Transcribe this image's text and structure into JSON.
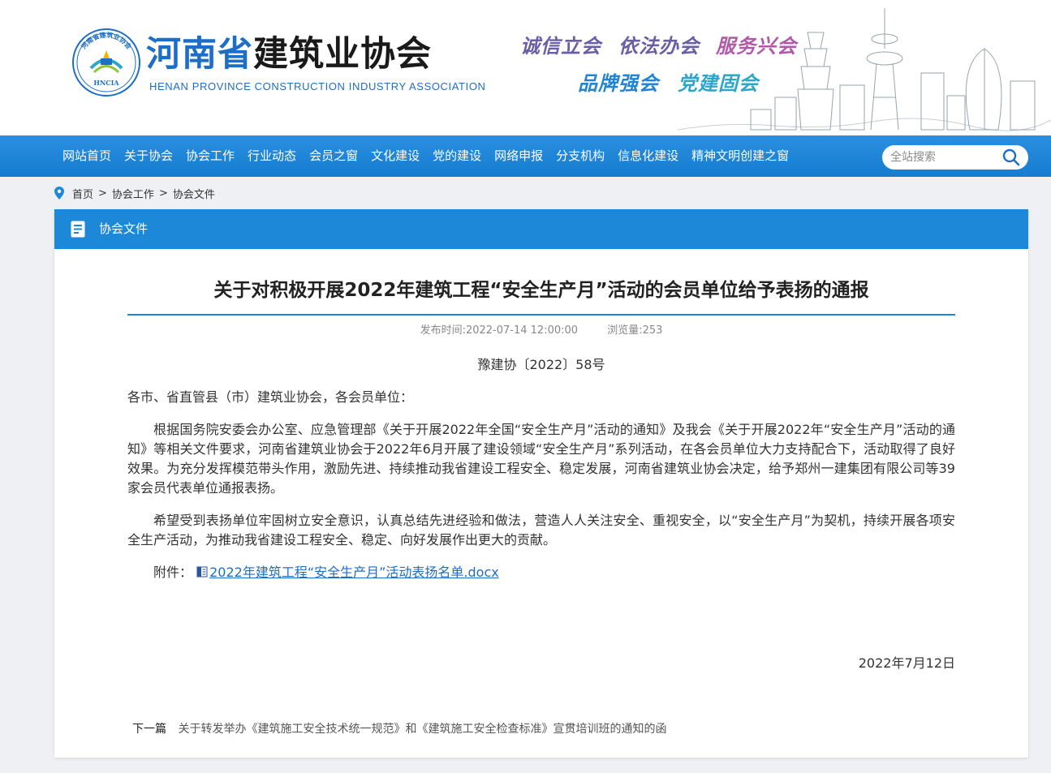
{
  "header": {
    "title_part1": "河南省",
    "title_part2": "建筑业协会",
    "subtitle": "HENAN PROVINCE CONSTRUCTION INDUSTRY ASSOCIATION",
    "emblem_top_text": "河南省建筑业协会",
    "emblem_bottom_text": "HNCIA",
    "slogans": [
      "诚信立会",
      "依法办会",
      "服务兴会",
      "品牌强会",
      "党建固会"
    ],
    "slogan_colors": [
      "#6a5fa6",
      "#6a5fa6",
      "#b15ba8",
      "#2184d4",
      "#2ca6c9"
    ]
  },
  "nav": {
    "items": [
      "网站首页",
      "关于协会",
      "协会工作",
      "行业动态",
      "会员之窗",
      "文化建设",
      "党的建设",
      "网络申报",
      "分支机构",
      "信息化建设",
      "精神文明创建之窗"
    ],
    "search_placeholder": "全站搜索"
  },
  "breadcrumb": {
    "items": [
      "首页",
      "协会工作",
      "协会文件"
    ],
    "separator": ">"
  },
  "section": {
    "title": "协会文件"
  },
  "article": {
    "title": "关于对积极开展2022年建筑工程“安全生产月”活动的会员单位给予表扬的通报",
    "publish_time": "发布时间:2022-07-14 12:00:00",
    "views": "浏览量:253",
    "doc_number": "豫建协〔2022〕58号",
    "salutation": "各市、省直管县（市）建筑业协会，各会员单位：",
    "paragraphs": [
      "根据国务院安委会办公室、应急管理部《关于开展2022年全国“安全生产月”活动的通知》及我会《关于开展2022年“安全生产月”活动的通知》等相关文件要求，河南省建筑业协会于2022年6月开展了建设领域“安全生产月”系列活动，在各会员单位大力支持配合下，活动取得了良好效果。为充分发挥模范带头作用，激励先进、持续推动我省建设工程安全、稳定发展，河南省建筑业协会决定，给予郑州一建集团有限公司等39家会员代表单位通报表扬。",
      "希望受到表扬单位牢固树立安全意识，认真总结先进经验和做法，营造人人关注安全、重视安全，以“安全生产月”为契机，持续开展各项安全生产活动，为推动我省建设工程安全、稳定、向好发展作出更大的贡献。"
    ],
    "attachment_label": "附件：",
    "attachment_name": "2022年建筑工程“安全生产月”活动表扬名单.docx",
    "date": "2022年7月12日"
  },
  "next": {
    "label": "下一篇",
    "title": "关于转发举办《建筑施工安全技术统一规范》和《建筑施工安全检查标准》宣贯培训班的通知的函"
  },
  "colors": {
    "brand_blue": "#1e88d8",
    "nav_blue": "#157ccf",
    "link_blue": "#1d6ec7"
  }
}
